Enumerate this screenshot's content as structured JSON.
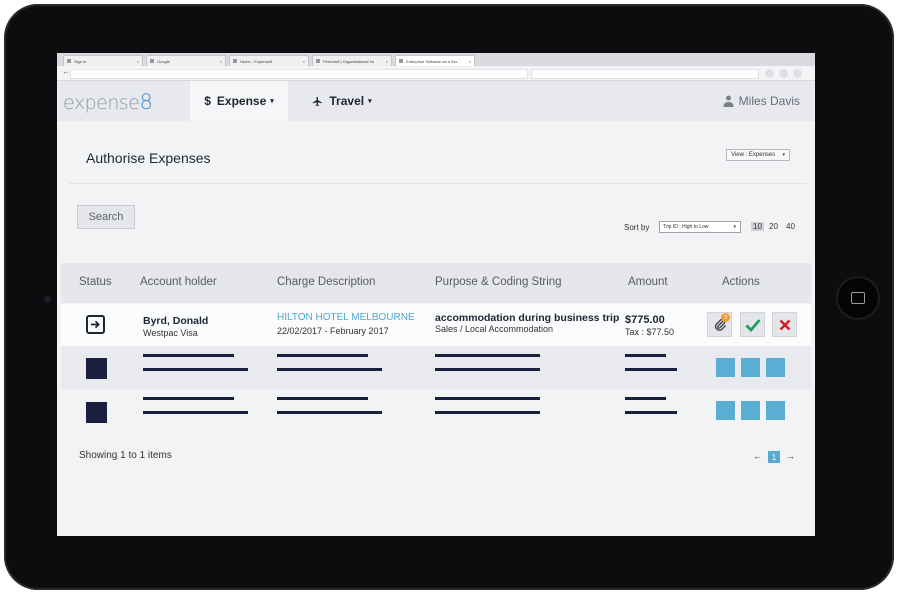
{
  "browser": {
    "tabs": [
      {
        "label": "Sign in"
      },
      {
        "label": "Google"
      },
      {
        "label": "Home - Expense8"
      },
      {
        "label": "Perform8 | Organisational Im"
      },
      {
        "label": "Enterprise Software as a Ser..."
      }
    ],
    "tab_close": "×",
    "back_glyph": "←"
  },
  "header": {
    "logo_text": "expense",
    "logo_suffix": "8",
    "nav": {
      "expense_symbol": "$",
      "expense_label": "Expense",
      "travel_label": "Travel",
      "caret": "▾"
    },
    "user_name": "Miles Davis"
  },
  "page": {
    "title": "Authorise Expenses",
    "view_select": "View : Expenses",
    "select_caret": "▾",
    "search_button": "Search",
    "sort_label": "Sort by",
    "sort_value": "Trip ID : High to Low",
    "page_sizes": [
      "10",
      "20",
      "40"
    ]
  },
  "table": {
    "columns": [
      "Status",
      "Account holder",
      "Charge Description",
      "Purpose & Coding String",
      "Amount",
      "Actions"
    ],
    "row": {
      "account_name": "Byrd, Donald",
      "account_card": "Westpac Visa",
      "charge_name": "HILTON HOTEL MELBOURNE",
      "charge_dates": "22/02/2017 - February 2017",
      "purpose": "accommodation during business trip",
      "coding": "Sales / Local Accommodation",
      "amount": "$775.00",
      "tax": "Tax : $77.50",
      "attachment_count": "3"
    }
  },
  "footer": {
    "showing": "Showing 1 to 1 items",
    "prev": "←",
    "next": "→",
    "current_page": "1"
  },
  "colors": {
    "accent": "#3d8fc4",
    "navy": "#1a1f3d",
    "placeholder_action": "#5aaed4",
    "approve": "#1da05a",
    "reject": "#d0202c",
    "attachment_badge": "#f29a2a"
  },
  "icons": {
    "status": "arrow-in-box-icon",
    "attach": "paperclip-icon",
    "approve": "checkmark-icon",
    "reject": "x-icon",
    "travel": "airplane-icon",
    "user": "user-icon"
  }
}
